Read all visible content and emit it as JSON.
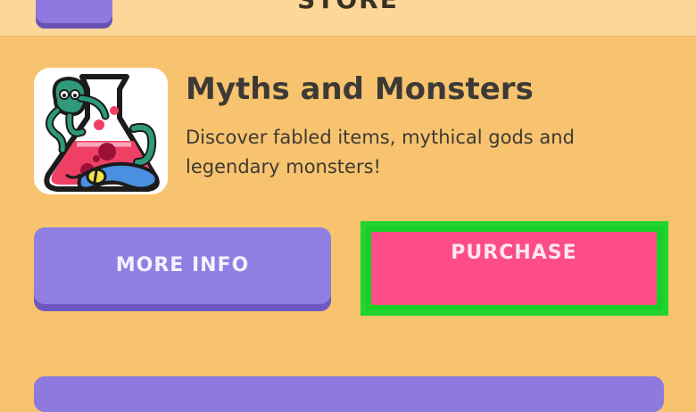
{
  "header": {
    "title": "STORE"
  },
  "pack": {
    "title": "Myths and Monsters",
    "description": "Discover fabled items, mythical gods and legendary monsters!",
    "icon": "potion-octopus-icon"
  },
  "actions": {
    "more_info_label": "MORE INFO",
    "purchase_label": "PURCHASE"
  },
  "colors": {
    "background": "#f8c36e",
    "primary_button": "#8f7fe2",
    "purchase_button": "#fd4d86",
    "highlight": "#21d42e"
  }
}
